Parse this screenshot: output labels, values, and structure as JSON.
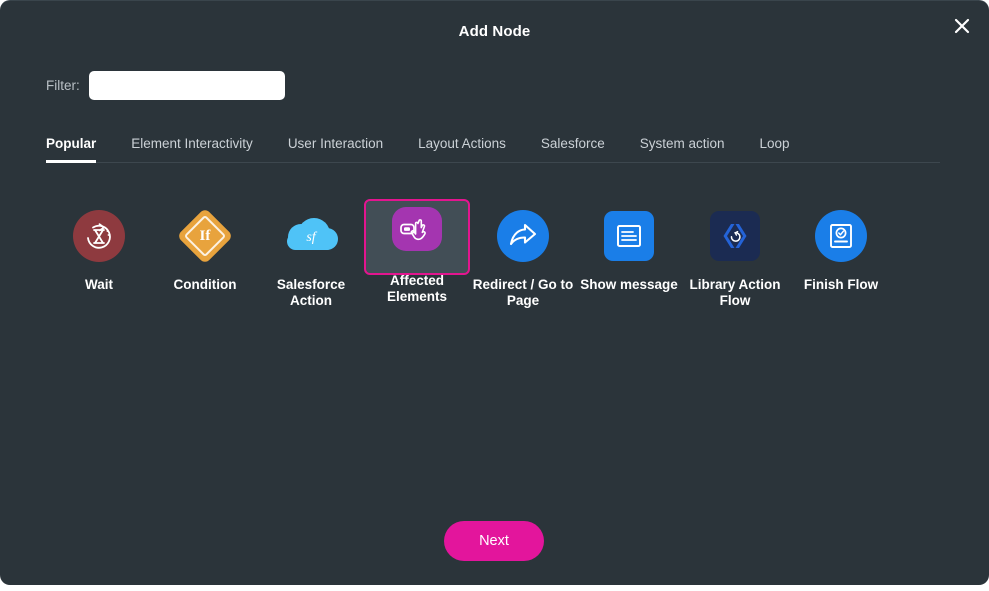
{
  "dialog": {
    "title": "Add Node",
    "close_icon": "close-icon"
  },
  "filter": {
    "label": "Filter:",
    "value": "",
    "placeholder": ""
  },
  "tabs": [
    {
      "label": "Popular",
      "active": true
    },
    {
      "label": "Element Interactivity",
      "active": false
    },
    {
      "label": "User Interaction",
      "active": false
    },
    {
      "label": "Layout Actions",
      "active": false
    },
    {
      "label": "Salesforce",
      "active": false
    },
    {
      "label": "System action",
      "active": false
    },
    {
      "label": "Loop",
      "active": false
    }
  ],
  "nodes": [
    {
      "label": "Wait",
      "icon": "hourglass-refresh-icon",
      "selected": false,
      "color": "#8e3a3f"
    },
    {
      "label": "Condition",
      "icon": "if-diamond-icon",
      "selected": false,
      "color": "#e8a33d"
    },
    {
      "label": "Salesforce Action",
      "icon": "salesforce-cloud-icon",
      "selected": false,
      "color": "#4fc3f7"
    },
    {
      "label": "Affected Elements",
      "icon": "pointer-hand-icon",
      "selected": true,
      "color": "#a435b0"
    },
    {
      "label": "Redirect / Go to Page",
      "icon": "share-arrow-icon",
      "selected": false,
      "color": "#1a7ee8"
    },
    {
      "label": "Show message",
      "icon": "message-box-icon",
      "selected": false,
      "color": "#1a7ee8"
    },
    {
      "label": "Library Action Flow",
      "icon": "code-brackets-refresh-icon",
      "selected": false,
      "color": "#1b2b52"
    },
    {
      "label": "Finish Flow",
      "icon": "checkmark-card-icon",
      "selected": false,
      "color": "#1a7ee8"
    }
  ],
  "footer": {
    "next_label": "Next"
  },
  "colors": {
    "dialog_background": "#2b343a",
    "accent_pink": "#e3159c",
    "selection_border": "#e3158f",
    "selected_tile_background": "#424e56",
    "text_primary": "#ffffff",
    "text_muted": "#b9c0c5"
  }
}
